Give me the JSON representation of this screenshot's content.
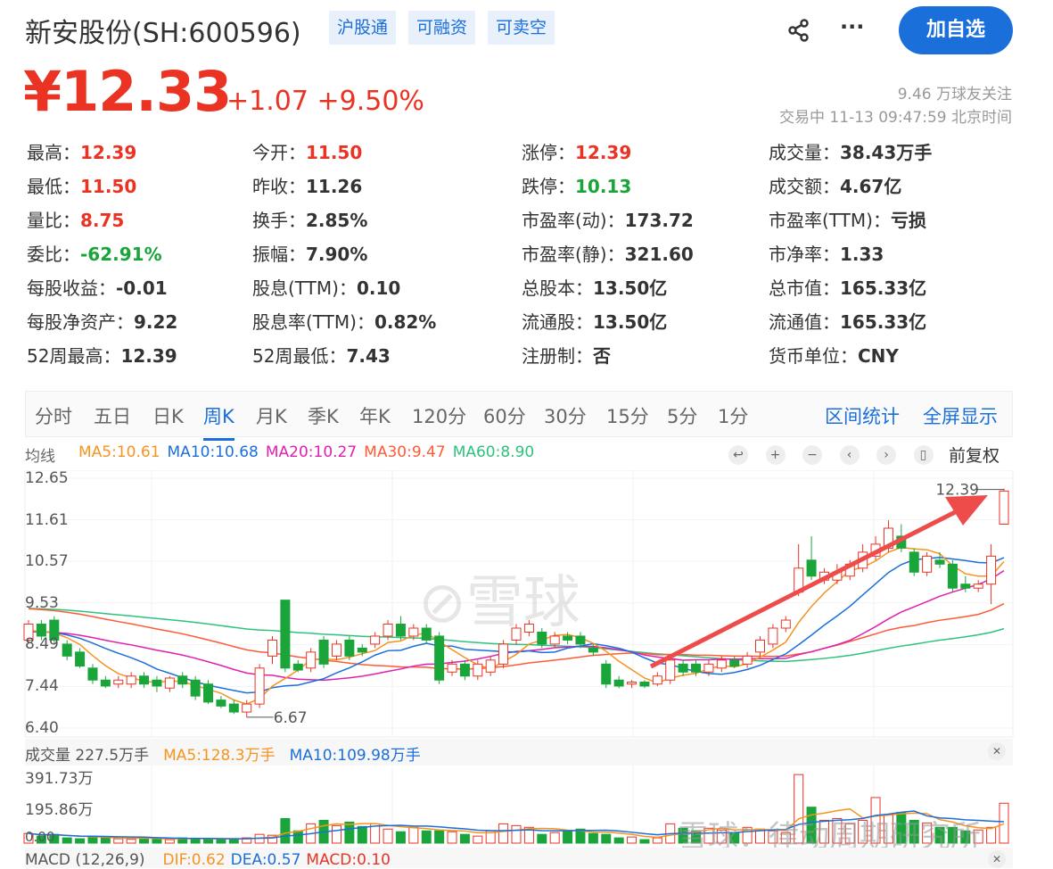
{
  "header": {
    "title": "新安股份(SH:600596)",
    "tags": [
      "沪股通",
      "可融资",
      "可卖空"
    ],
    "share_icon": "share-icon",
    "more_icon": "more-icon",
    "add_button": "加自选"
  },
  "quote": {
    "price": "¥12.33",
    "change": "+1.07",
    "change_pct": "+9.50%",
    "followers": "9.46 万球友关注",
    "status": "交易中 11-13 09:47:59 北京时间"
  },
  "stats": [
    [
      {
        "l": "最高：",
        "v": "12.39",
        "c": "up"
      },
      {
        "l": "最低：",
        "v": "11.50",
        "c": "up"
      },
      {
        "l": "量比：",
        "v": "8.75",
        "c": "up"
      },
      {
        "l": "委比：",
        "v": "-62.91%",
        "c": "dn"
      },
      {
        "l": "每股收益：",
        "v": "-0.01",
        "c": ""
      },
      {
        "l": "每股净资产：",
        "v": "9.22",
        "c": ""
      },
      {
        "l": "52周最高：",
        "v": "12.39",
        "c": ""
      }
    ],
    [
      {
        "l": "今开：",
        "v": "11.50",
        "c": "up"
      },
      {
        "l": "昨收：",
        "v": "11.26",
        "c": ""
      },
      {
        "l": "换手：",
        "v": "2.85%",
        "c": ""
      },
      {
        "l": "振幅：",
        "v": "7.90%",
        "c": ""
      },
      {
        "l": "股息(TTM)：",
        "v": "0.10",
        "c": ""
      },
      {
        "l": "股息率(TTM)：",
        "v": "0.82%",
        "c": ""
      },
      {
        "l": "52周最低：",
        "v": "7.43",
        "c": ""
      }
    ],
    [
      {
        "l": "涨停：",
        "v": "12.39",
        "c": "up"
      },
      {
        "l": "跌停：",
        "v": "10.13",
        "c": "dn"
      },
      {
        "l": "市盈率(动)：",
        "v": "173.72",
        "c": ""
      },
      {
        "l": "市盈率(静)：",
        "v": "321.60",
        "c": ""
      },
      {
        "l": "总股本：",
        "v": "13.50亿",
        "c": ""
      },
      {
        "l": "流通股：",
        "v": "13.50亿",
        "c": ""
      },
      {
        "l": "注册制：",
        "v": "否",
        "c": ""
      }
    ],
    [
      {
        "l": "成交量：",
        "v": "38.43万手",
        "c": ""
      },
      {
        "l": "成交额：",
        "v": "4.67亿",
        "c": ""
      },
      {
        "l": "市盈率(TTM)：",
        "v": "亏损",
        "c": ""
      },
      {
        "l": "市净率：",
        "v": "1.33",
        "c": ""
      },
      {
        "l": "总市值：",
        "v": "165.33亿",
        "c": ""
      },
      {
        "l": "流通值：",
        "v": "165.33亿",
        "c": ""
      },
      {
        "l": "货币单位：",
        "v": "CNY",
        "c": ""
      }
    ]
  ],
  "tabs": [
    "分时",
    "五日",
    "日K",
    "周K",
    "月K",
    "季K",
    "年K",
    "120分",
    "60分",
    "30分",
    "15分",
    "5分",
    "1分"
  ],
  "active_tab": "周K",
  "tab_actions": [
    "区间统计",
    "全屏显示"
  ],
  "ma_legend": {
    "label": "均线",
    "items": [
      {
        "t": "MA5:10.61",
        "c": "#f7931e"
      },
      {
        "t": "MA10:10.68",
        "c": "#1a6fdb"
      },
      {
        "t": "MA20:10.27",
        "c": "#e020b0"
      },
      {
        "t": "MA30:9.47",
        "c": "#ff5a36"
      },
      {
        "t": "MA60:8.90",
        "c": "#2ec27e"
      }
    ]
  },
  "chart_controls": [
    "undo-icon",
    "zoom-in-icon",
    "zoom-out-icon",
    "left-icon",
    "right-icon",
    "candle-icon"
  ],
  "adjust": "前复权",
  "chart_data": {
    "type": "candlestick",
    "y_ticks": [
      "12.65",
      "11.61",
      "10.57",
      "9.53",
      "8.49",
      "7.44",
      "6.40"
    ],
    "ylim": [
      6.4,
      12.65
    ],
    "max_label": "12.39",
    "min_label": "6.67",
    "ohlc": [
      [
        8.6,
        9.1,
        8.5,
        9.0
      ],
      [
        9.0,
        9.1,
        8.6,
        8.7
      ],
      [
        9.1,
        9.2,
        8.5,
        8.6
      ],
      [
        8.5,
        8.6,
        8.1,
        8.2
      ],
      [
        8.3,
        8.4,
        7.9,
        7.95
      ],
      [
        7.9,
        8.0,
        7.5,
        7.6
      ],
      [
        7.6,
        7.7,
        7.4,
        7.45
      ],
      [
        7.5,
        7.7,
        7.4,
        7.6
      ],
      [
        7.5,
        7.8,
        7.4,
        7.7
      ],
      [
        7.7,
        7.8,
        7.4,
        7.5
      ],
      [
        7.6,
        7.7,
        7.3,
        7.45
      ],
      [
        7.4,
        7.7,
        7.3,
        7.65
      ],
      [
        7.7,
        7.8,
        7.4,
        7.5
      ],
      [
        7.6,
        7.7,
        7.1,
        7.2
      ],
      [
        7.5,
        7.6,
        7.0,
        7.05
      ],
      [
        7.1,
        7.2,
        6.9,
        6.95
      ],
      [
        7.0,
        7.1,
        6.75,
        6.8
      ],
      [
        6.8,
        7.1,
        6.67,
        7.0
      ],
      [
        7.0,
        8.0,
        6.9,
        7.9
      ],
      [
        8.2,
        8.7,
        8.0,
        8.6
      ],
      [
        9.6,
        9.6,
        7.8,
        7.9
      ],
      [
        8.0,
        8.1,
        7.8,
        7.85
      ],
      [
        7.9,
        8.4,
        7.8,
        8.3
      ],
      [
        8.6,
        8.7,
        7.9,
        8.0
      ],
      [
        8.2,
        8.6,
        8.1,
        8.5
      ],
      [
        8.6,
        8.7,
        8.1,
        8.2
      ],
      [
        8.4,
        8.5,
        8.2,
        8.3
      ],
      [
        8.5,
        8.8,
        8.4,
        8.7
      ],
      [
        8.7,
        9.1,
        8.6,
        9.0
      ],
      [
        9.0,
        9.2,
        8.6,
        8.7
      ],
      [
        8.7,
        9.0,
        8.6,
        8.9
      ],
      [
        8.9,
        9.0,
        8.5,
        8.6
      ],
      [
        8.7,
        8.8,
        7.5,
        7.6
      ],
      [
        7.8,
        8.1,
        7.7,
        8.0
      ],
      [
        8.0,
        8.1,
        7.6,
        7.7
      ],
      [
        7.7,
        8.1,
        7.6,
        8.0
      ],
      [
        7.8,
        8.2,
        7.7,
        8.1
      ],
      [
        8.0,
        8.6,
        7.9,
        8.5
      ],
      [
        8.6,
        9.0,
        8.5,
        8.9
      ],
      [
        8.8,
        9.1,
        8.7,
        9.0
      ],
      [
        8.8,
        8.9,
        8.4,
        8.5
      ],
      [
        8.5,
        8.8,
        8.4,
        8.7
      ],
      [
        8.7,
        8.8,
        8.5,
        8.6
      ],
      [
        8.7,
        8.8,
        8.4,
        8.5
      ],
      [
        8.4,
        8.5,
        8.2,
        8.3
      ],
      [
        8.0,
        8.1,
        7.4,
        7.5
      ],
      [
        7.6,
        7.7,
        7.4,
        7.45
      ],
      [
        7.5,
        7.6,
        7.4,
        7.55
      ],
      [
        7.55,
        7.6,
        7.4,
        7.45
      ],
      [
        7.5,
        7.8,
        7.45,
        7.7
      ],
      [
        7.6,
        8.2,
        7.5,
        8.1
      ],
      [
        8.0,
        8.1,
        7.7,
        7.8
      ],
      [
        8.0,
        8.1,
        7.7,
        7.8
      ],
      [
        7.8,
        8.1,
        7.7,
        8.0
      ],
      [
        7.9,
        8.2,
        7.8,
        8.1
      ],
      [
        8.1,
        8.2,
        7.9,
        7.95
      ],
      [
        8.0,
        8.3,
        7.9,
        8.2
      ],
      [
        8.3,
        8.7,
        8.2,
        8.6
      ],
      [
        8.5,
        9.0,
        8.4,
        8.9
      ],
      [
        8.9,
        9.2,
        8.8,
        9.1
      ],
      [
        9.8,
        11.0,
        9.7,
        10.4
      ],
      [
        10.6,
        11.2,
        10.1,
        10.2
      ],
      [
        10.1,
        10.4,
        10.0,
        10.3
      ],
      [
        10.1,
        10.5,
        10.0,
        10.3
      ],
      [
        10.2,
        10.6,
        10.1,
        10.5
      ],
      [
        10.4,
        11.0,
        10.3,
        10.8
      ],
      [
        10.7,
        11.2,
        10.6,
        11.0
      ],
      [
        10.9,
        11.6,
        10.8,
        11.4
      ],
      [
        11.2,
        11.5,
        10.8,
        10.9
      ],
      [
        10.8,
        10.9,
        10.2,
        10.3
      ],
      [
        10.3,
        10.8,
        10.2,
        10.7
      ],
      [
        10.6,
        10.8,
        10.4,
        10.5
      ],
      [
        10.5,
        10.6,
        9.8,
        9.9
      ],
      [
        10.0,
        10.2,
        9.8,
        9.9
      ],
      [
        9.9,
        10.1,
        9.8,
        10.0
      ],
      [
        10.0,
        11.0,
        9.5,
        10.7
      ],
      [
        11.5,
        12.39,
        11.5,
        12.33
      ]
    ],
    "volume": {
      "label": "成交量 227.5万手",
      "ma5": "MA5:128.3万手",
      "ma10": "MA10:109.98万手",
      "y_ticks": [
        "391.73万",
        "195.86万",
        "0.00"
      ],
      "ymax": 391.73,
      "values": [
        55,
        40,
        50,
        30,
        25,
        35,
        30,
        25,
        22,
        30,
        25,
        20,
        30,
        28,
        25,
        22,
        20,
        30,
        50,
        45,
        140,
        70,
        110,
        130,
        100,
        120,
        95,
        110,
        80,
        65,
        90,
        70,
        70,
        65,
        50,
        40,
        70,
        110,
        100,
        90,
        50,
        60,
        70,
        80,
        55,
        50,
        30,
        35,
        20,
        30,
        110,
        85,
        70,
        85,
        75,
        60,
        90,
        80,
        70,
        60,
        391,
        205,
        130,
        140,
        110,
        130,
        260,
        160,
        175,
        130,
        115,
        90,
        90,
        70,
        75,
        90,
        227.5
      ]
    },
    "macd": {
      "label": "MACD (12,26,9)",
      "dif": "DIF:0.62",
      "dea": "DEA:0.57",
      "macd": "MACD:0.10"
    }
  },
  "watermark": "雪球",
  "credit": "雪球：律动周期研究所"
}
